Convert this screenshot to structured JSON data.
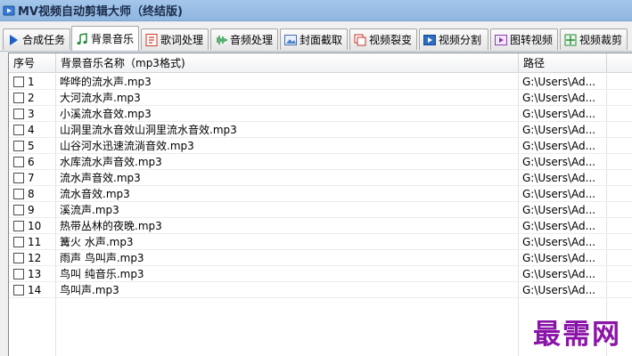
{
  "window": {
    "title": "MV视频自动剪辑大师（终结版)"
  },
  "tabs": [
    {
      "label": "合成任务",
      "icon": "play-icon"
    },
    {
      "label": "背景音乐",
      "icon": "music-note-icon",
      "selected": true
    },
    {
      "label": "歌词处理",
      "icon": "lyrics-icon"
    },
    {
      "label": "音频处理",
      "icon": "waveform-icon"
    },
    {
      "label": "封面截取",
      "icon": "image-icon"
    },
    {
      "label": "视频裂变",
      "icon": "copy-icon"
    },
    {
      "label": "视频分割",
      "icon": "video-split-icon"
    },
    {
      "label": "图转视频",
      "icon": "picture-to-video-icon"
    },
    {
      "label": "视频裁剪",
      "icon": "crop-icon"
    }
  ],
  "table": {
    "columns": [
      "序号",
      "背景音乐名称（mp3格式)",
      "路径"
    ],
    "rows": [
      {
        "index": "1",
        "name": "哗哗的流水声.mp3",
        "path": "G:\\Users\\Ad..."
      },
      {
        "index": "2",
        "name": "大河流水声.mp3",
        "path": "G:\\Users\\Ad..."
      },
      {
        "index": "3",
        "name": "小溪流水音效.mp3",
        "path": "G:\\Users\\Ad..."
      },
      {
        "index": "4",
        "name": "山洞里流水音效山洞里流水音效.mp3",
        "path": "G:\\Users\\Ad..."
      },
      {
        "index": "5",
        "name": "山谷河水迅速流淌音效.mp3",
        "path": "G:\\Users\\Ad..."
      },
      {
        "index": "6",
        "name": "水库流水声音效.mp3",
        "path": "G:\\Users\\Ad..."
      },
      {
        "index": "7",
        "name": "流水声音效.mp3",
        "path": "G:\\Users\\Ad..."
      },
      {
        "index": "8",
        "name": "流水音效.mp3",
        "path": "G:\\Users\\Ad..."
      },
      {
        "index": "9",
        "name": "溪流声.mp3",
        "path": "G:\\Users\\Ad..."
      },
      {
        "index": "10",
        "name": "热带丛林的夜晚.mp3",
        "path": "G:\\Users\\Ad..."
      },
      {
        "index": "11",
        "name": "篝火 水声.mp3",
        "path": "G:\\Users\\Ad..."
      },
      {
        "index": "12",
        "name": "雨声 鸟叫声.mp3",
        "path": "G:\\Users\\Ad..."
      },
      {
        "index": "13",
        "name": "鸟叫 纯音乐.mp3",
        "path": "G:\\Users\\Ad..."
      },
      {
        "index": "14",
        "name": "鸟叫声.mp3",
        "path": "G:\\Users\\Ad..."
      }
    ]
  },
  "watermark": "最需网"
}
